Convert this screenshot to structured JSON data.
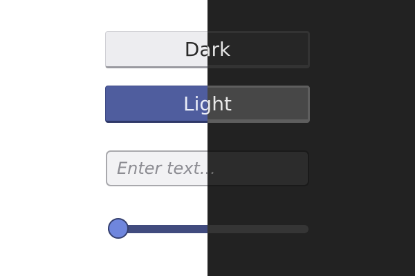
{
  "themes": {
    "light": {
      "background": "#ffffff",
      "accent": "#4f5d9e",
      "slider_thumb": "#6f86dd"
    },
    "dark": {
      "background": "#222222",
      "surface": "#474747"
    }
  },
  "buttons": {
    "dark_label": "Dark",
    "light_label": "Light"
  },
  "text_input": {
    "placeholder": "Enter text...",
    "value": ""
  },
  "slider": {
    "value": 0.0
  }
}
